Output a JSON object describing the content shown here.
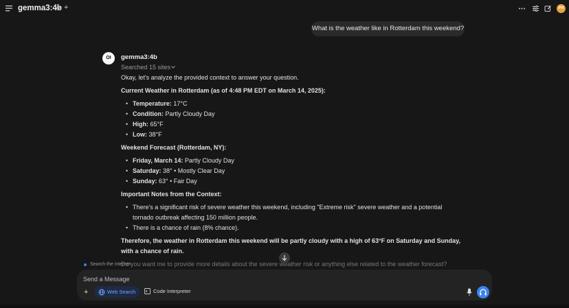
{
  "header": {
    "model_name": "gemma3:4b",
    "avatar_initials": "PH"
  },
  "user_message": "What is the weather like in Rotterdam this weekend?",
  "assistant": {
    "name": "gemma3:4b",
    "logo_text": "OI",
    "searched": "Searched 15 sites",
    "intro": "Okay, let's analyze the provided context to answer your question.",
    "current_heading": "Current Weather in Rotterdam (as of 4:48 PM EDT on March 14, 2025):",
    "current_items": [
      {
        "label": "Temperature:",
        "value": " 17°C"
      },
      {
        "label": "Condition:",
        "value": " Partly Cloudy Day"
      },
      {
        "label": "High:",
        "value": " 65°F"
      },
      {
        "label": "Low:",
        "value": " 38°F"
      }
    ],
    "forecast_heading": "Weekend Forecast (Rotterdam, NY):",
    "forecast_items": [
      {
        "label": "Friday, March 14:",
        "value": " Partly Cloudy Day"
      },
      {
        "label": "Saturday:",
        "value": " 38° • Mostly Clear Day"
      },
      {
        "label": "Sunday:",
        "value": " 63° • Fair Day"
      }
    ],
    "notes_heading": "Important Notes from the Context:",
    "notes_items": [
      "There's a significant risk of severe weather this weekend, including \"Extreme risk\" severe weather and a potential tornado outbreak affecting 150 million people.",
      "There is a chance of rain (8% chance)."
    ],
    "conclusion": "Therefore, the weather in Rotterdam this weekend will be partly cloudy with a high of 63°F on Saturday and Sunday, with a chance of rain.",
    "followup": "Do you want me to provide more details about the severe weather risk or anything else related to the weather forecast?"
  },
  "search_note": "Search the internet",
  "composer": {
    "placeholder": "Send a Message",
    "web_search_label": "Web Search",
    "code_interpreter_label": "Code Interpreter"
  },
  "colors": {
    "background": "#171717",
    "bubble": "#2a2a2a",
    "accent": "#3b82f6",
    "avatar": "#e9a23b"
  }
}
